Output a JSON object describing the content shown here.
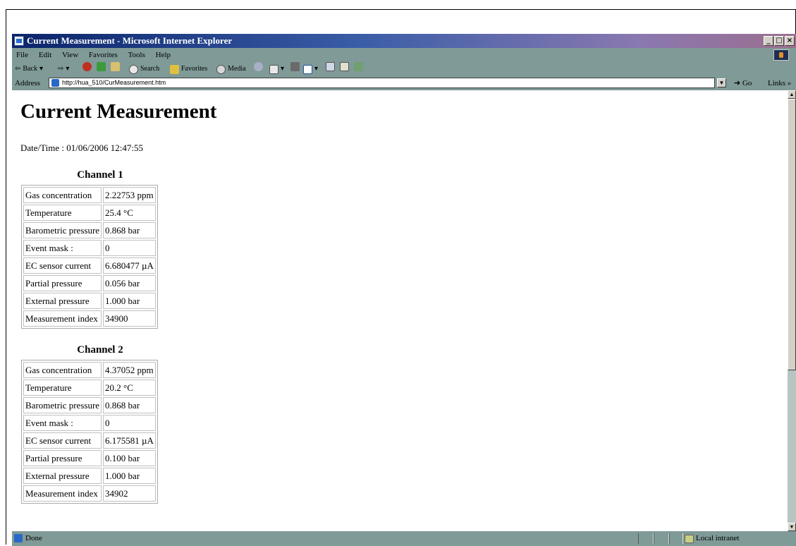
{
  "window": {
    "title": "Current Measurement - Microsoft Internet Explorer",
    "controls": [
      "_",
      "□",
      "×"
    ]
  },
  "menu": [
    "File",
    "Edit",
    "View",
    "Favorites",
    "Tools",
    "Help"
  ],
  "toolbar": {
    "back": "Back",
    "search": "Search",
    "favorites": "Favorites",
    "media": "Media"
  },
  "address": {
    "label": "Address",
    "url": "http://hua_510/CurMeasurement.htm",
    "go": "Go",
    "links": "Links »"
  },
  "page": {
    "heading": "Current Measurement",
    "datetime": "Date/Time : 01/06/2006 12:47:55",
    "channels": [
      {
        "title": "Channel 1",
        "rows": [
          {
            "label": "Gas concentration",
            "value": "2.22753 ppm"
          },
          {
            "label": "Temperature",
            "value": "25.4 °C"
          },
          {
            "label": "Barometric pressure",
            "value": "0.868 bar"
          },
          {
            "label": "Event mask :",
            "value": "0"
          },
          {
            "label": "EC sensor current",
            "value": "6.680477 µA"
          },
          {
            "label": "Partial pressure",
            "value": "0.056 bar"
          },
          {
            "label": "External pressure",
            "value": "1.000 bar"
          },
          {
            "label": "Measurement index",
            "value": "34900"
          }
        ]
      },
      {
        "title": "Channel 2",
        "rows": [
          {
            "label": "Gas concentration",
            "value": "4.37052 ppm"
          },
          {
            "label": "Temperature",
            "value": "20.2 °C"
          },
          {
            "label": "Barometric pressure",
            "value": "0.868 bar"
          },
          {
            "label": "Event mask :",
            "value": "0"
          },
          {
            "label": "EC sensor current",
            "value": "6.175581 µA"
          },
          {
            "label": "Partial pressure",
            "value": "0.100 bar"
          },
          {
            "label": "External pressure",
            "value": "1.000 bar"
          },
          {
            "label": "Measurement index",
            "value": "34902"
          }
        ]
      }
    ]
  },
  "status": {
    "text": "Done",
    "zone": "Local intranet"
  },
  "colors": {
    "chrome": "#7f9a97",
    "title_start": "#0a246a",
    "title_end": "#9c6f8f"
  }
}
